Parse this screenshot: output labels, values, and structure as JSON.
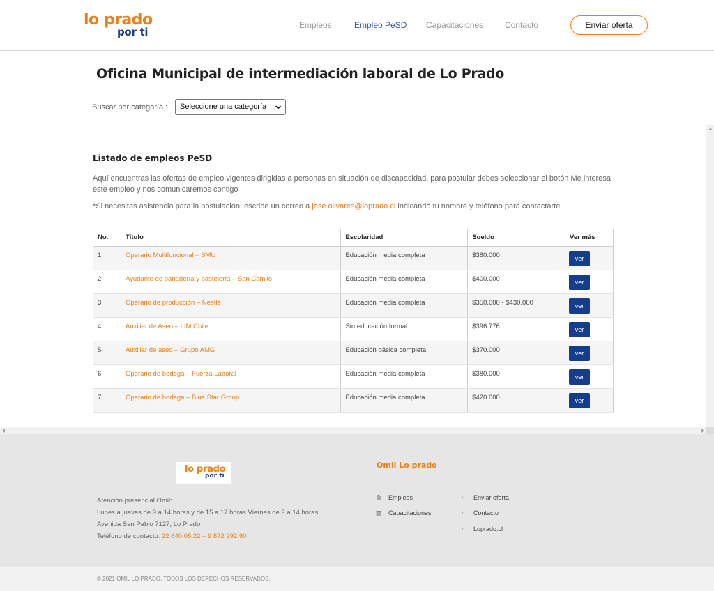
{
  "header": {
    "logo_line1": "lo prado",
    "logo_line2": "por ti",
    "nav": [
      "Empleos",
      "Empleo PeSD",
      "Capacitaciones",
      "Contacto"
    ],
    "cta": "Enviar oferta"
  },
  "main": {
    "title": "Oficina Municipal de intermediación laboral de Lo Prado",
    "filter_label": "Buscar por categoría :",
    "filter_selected": "Seleccione una categoría",
    "list_title": "Listado de empleos PeSD",
    "list_desc": "Aquí encuentras las ofertas de empleo vigentes dirigidas a personas en situación de discapacidad, para postular debes seleccionar el botón Me interesa este empleo y nos comunicaremos contigo",
    "note_before": "*Si necesitas asistencia para la postulación, escribe un correo a ",
    "note_email": "jose.olivares@loprado.cl",
    "note_after": " indicando tu nombre y teléfono para contactarte."
  },
  "table": {
    "headers": [
      "No.",
      "Título",
      "Escolaridad",
      "Sueldo",
      "Ver más"
    ],
    "button_label": "ver",
    "rows": [
      {
        "no": "1",
        "titulo": "Operario Multifuncional – SMU",
        "escolaridad": "Educación media completa",
        "sueldo": "$380.000"
      },
      {
        "no": "2",
        "titulo": "Ayudante de panadería y pastelería – San Camilo",
        "escolaridad": "Educación media completa",
        "sueldo": "$400.000"
      },
      {
        "no": "3",
        "titulo": "Operario de producción – Nestlé",
        "escolaridad": "Educación media completa",
        "sueldo": "$350.000 - $430.000"
      },
      {
        "no": "4",
        "titulo": "Auxiliar de Aseo – LIM Chile",
        "escolaridad": "Sin educación formal",
        "sueldo": "$396.776"
      },
      {
        "no": "5",
        "titulo": "Auxiliar de aseo – Grupo AMG",
        "escolaridad": "Educación básica completa",
        "sueldo": "$370.000"
      },
      {
        "no": "6",
        "titulo": "Operario de bodega – Fuerza Laboral",
        "escolaridad": "Educación media completa",
        "sueldo": "$380.000"
      },
      {
        "no": "7",
        "titulo": "Operario de bodega – Blue Star Group",
        "escolaridad": "Educación media completa",
        "sueldo": "$420.000"
      }
    ]
  },
  "footer": {
    "info_line1": "Atención presencial Omil:",
    "info_line2": "Lunes a jueves de 9 a 14 horas  y de 15 a 17 horas Viernes de 9 a 14 horas",
    "info_line3": "Avenida San Pablo 7127, Lo Prado",
    "phone_label": "Teléfono de contacto: ",
    "phones": "22 640 05 22 – 9 872 992 90",
    "section_title": "Omil Lo prado",
    "links_col1": [
      "Empleos",
      "Capacitaciones"
    ],
    "links_col2": [
      "Enviar oferta",
      "Contacto",
      "Loprado.cl"
    ],
    "copyright": "© 2021 OMIL LO PRADO, TODOS LOS DERECHOS RESERVADOS."
  },
  "colors": {
    "accent": "#f07d16",
    "brand_blue": "#1a3a8f",
    "button_blue": "#143d8c",
    "nav_active": "#3a55a8"
  }
}
